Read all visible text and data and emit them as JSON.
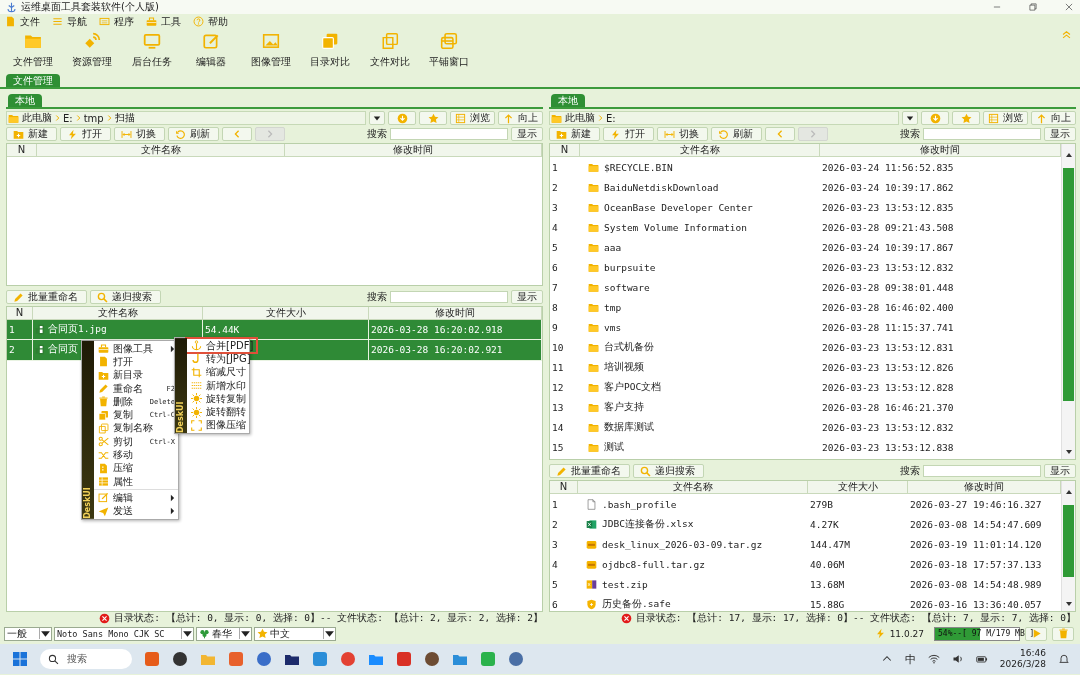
{
  "window": {
    "title": "运维桌面工具套装软件(个人版)"
  },
  "menu": [
    {
      "label": "文件"
    },
    {
      "label": "导航"
    },
    {
      "label": "程序"
    },
    {
      "label": "工具"
    },
    {
      "label": "帮助"
    }
  ],
  "toolbar": [
    {
      "label": "文件管理"
    },
    {
      "label": "资源管理"
    },
    {
      "label": "后台任务"
    },
    {
      "label": "编辑器"
    },
    {
      "label": "图像管理"
    },
    {
      "label": "目录对比"
    },
    {
      "label": "文件对比"
    },
    {
      "label": "平铺窗口"
    }
  ],
  "main_tabs": [
    {
      "label": "文件管理",
      "selected": true
    }
  ],
  "panes": [
    {
      "tab": {
        "label": "本地",
        "selected": true
      },
      "path": [
        "此电脑",
        "E:",
        "tmp",
        "扫描"
      ],
      "nav_buttons": [
        {
          "label": "浏览"
        },
        {
          "label": "向上"
        }
      ],
      "actions": [
        {
          "label": "新建"
        },
        {
          "label": "打开"
        },
        {
          "label": "切换"
        },
        {
          "label": "刷新"
        }
      ],
      "history": [
        {
          "disabled": false
        },
        {
          "disabled": true
        }
      ],
      "search_label": "搜索",
      "show_button": "显示",
      "dirs": {
        "columns": [
          "N",
          "文件名称",
          "修改时间"
        ]
      },
      "file_tools": [
        {
          "label": "批量重命名"
        },
        {
          "label": "递归搜索"
        }
      ],
      "files_search_label": "搜索",
      "files_show_button": "显示",
      "files": {
        "columns": [
          "N",
          "文件名称",
          "文件大小",
          "修改时间"
        ],
        "rows": [
          {
            "n": "1",
            "kind": "image",
            "name": "合同页1.jpg",
            "size": "54.44K",
            "time": "2026-03-28 16:20:02.918",
            "selected": true
          },
          {
            "n": "2",
            "kind": "image",
            "name": "合同页",
            "time": "2026-03-28 16:20:02.921",
            "selected": true
          }
        ]
      },
      "status": "目录状态: 【总计: 0, 显示: 0, 选择: 0】-- 文件状态: 【总计: 2, 显示: 2, 选择: 2】"
    },
    {
      "tab": {
        "label": "本地",
        "selected": true
      },
      "path": [
        "此电脑",
        "E:"
      ],
      "nav_buttons": [
        {
          "label": "浏览"
        },
        {
          "label": "向上"
        }
      ],
      "actions": [
        {
          "label": "新建"
        },
        {
          "label": "打开"
        },
        {
          "label": "切换"
        },
        {
          "label": "刷新"
        }
      ],
      "history": [
        {
          "disabled": false
        },
        {
          "disabled": true
        }
      ],
      "search_label": "搜索",
      "show_button": "显示",
      "dirs": {
        "columns": [
          "N",
          "文件名称",
          "修改时间"
        ],
        "rows": [
          {
            "n": "1",
            "name": "$RECYCLE.BIN",
            "time": "2026-03-24 11:56:52.835",
            "selected": false
          },
          {
            "n": "2",
            "name": "BaiduNetdiskDownload",
            "time": "2026-03-24 10:39:17.862",
            "selected": false
          },
          {
            "n": "3",
            "name": "OceanBase Developer Center",
            "time": "2026-03-23 13:53:12.835",
            "selected": false
          },
          {
            "n": "4",
            "name": "System Volume Information",
            "time": "2026-03-28 09:21:43.508",
            "selected": false
          },
          {
            "n": "5",
            "name": "aaa",
            "time": "2026-03-24 10:39:17.867",
            "selected": false
          },
          {
            "n": "6",
            "name": "burpsuite",
            "time": "2026-03-23 13:53:12.832",
            "selected": false
          },
          {
            "n": "7",
            "name": "software",
            "time": "2026-03-28 09:38:01.448",
            "selected": false
          },
          {
            "n": "8",
            "name": "tmp",
            "time": "2026-03-28 16:46:02.400",
            "selected": false
          },
          {
            "n": "9",
            "name": "vms",
            "time": "2026-03-28 11:15:37.741",
            "selected": false
          },
          {
            "n": "10",
            "name": "台式机备份",
            "time": "2026-03-23 13:53:12.831",
            "selected": false
          },
          {
            "n": "11",
            "name": "培训视频",
            "time": "2026-03-23 13:53:12.826",
            "selected": false
          },
          {
            "n": "12",
            "name": "客户POC文档",
            "time": "2026-03-23 13:53:12.828",
            "selected": false
          },
          {
            "n": "13",
            "name": "客户支持",
            "time": "2026-03-28 16:46:21.370",
            "selected": false
          },
          {
            "n": "14",
            "name": "数据库测试",
            "time": "2026-03-23 13:53:12.832",
            "selected": false
          },
          {
            "n": "15",
            "name": "测试",
            "time": "2026-03-23 13:53:12.838",
            "selected": false
          }
        ]
      },
      "file_tools": [
        {
          "label": "批量重命名"
        },
        {
          "label": "递归搜索"
        }
      ],
      "files_search_label": "搜索",
      "files_show_button": "显示",
      "files": {
        "columns": [
          "N",
          "文件名称",
          "文件大小",
          "修改时间"
        ],
        "rows": [
          {
            "n": "1",
            "kind": "file",
            "name": ".bash_profile",
            "size": "279B",
            "time": "2026-03-27 19:46:16.327",
            "selected": false
          },
          {
            "n": "2",
            "kind": "excel",
            "name": "JDBC连接备份.xlsx",
            "size": "4.27K",
            "time": "2026-03-08 14:54:47.609",
            "selected": false
          },
          {
            "n": "3",
            "kind": "archive",
            "name": "desk_linux_2026-03-09.tar.gz",
            "size": "144.47M",
            "time": "2026-03-19 11:01:14.120",
            "selected": false
          },
          {
            "n": "4",
            "kind": "archive",
            "name": "ojdbc8-full.tar.gz",
            "size": "40.06M",
            "time": "2026-03-18 17:57:37.133",
            "selected": false
          },
          {
            "n": "5",
            "kind": "zip",
            "name": "test.zip",
            "size": "13.68M",
            "time": "2026-03-08 14:54:48.989",
            "selected": false
          },
          {
            "n": "6",
            "kind": "safe",
            "name": "历史备份.safe",
            "size": "15.88G",
            "time": "2026-03-16 13:36:40.057",
            "selected": false
          }
        ]
      },
      "status": "目录状态: 【总计: 17, 显示: 17, 选择: 0】-- 文件状态: 【总计: 7, 显示: 7, 选择: 0】"
    }
  ],
  "context_menu": {
    "brand": "DeskUI",
    "items": [
      {
        "kind": "item",
        "label": "图像工具",
        "submenu": true
      },
      {
        "kind": "item",
        "label": "打开"
      },
      {
        "kind": "item",
        "label": "新目录"
      },
      {
        "kind": "item",
        "label": "重命名",
        "shortcut": "F2"
      },
      {
        "kind": "item",
        "label": "删除",
        "shortcut": "Delete"
      },
      {
        "kind": "item",
        "label": "复制",
        "shortcut": "Ctrl-C"
      },
      {
        "kind": "item",
        "label": "复制名称"
      },
      {
        "kind": "item",
        "label": "剪切",
        "shortcut": "Ctrl-X"
      },
      {
        "kind": "item",
        "label": "移动"
      },
      {
        "kind": "item",
        "label": "压缩"
      },
      {
        "kind": "item",
        "label": "属性"
      },
      {
        "kind": "separator"
      },
      {
        "kind": "item",
        "label": "编辑",
        "submenu": true
      },
      {
        "kind": "item",
        "label": "发送",
        "submenu": true
      }
    ],
    "submenu": {
      "brand": "DeskUI",
      "items": [
        {
          "label": "合并[PDF]",
          "selected": true
        },
        {
          "label": "转为[JPG]",
          "selected": false
        },
        {
          "label": "缩减尺寸",
          "selected": false
        },
        {
          "label": "新增水印",
          "selected": false
        },
        {
          "label": "旋转复制",
          "selected": false
        },
        {
          "label": "旋转翻转",
          "selected": false
        },
        {
          "label": "图像压缩",
          "selected": false
        }
      ]
    }
  },
  "bottom_bar": {
    "dropdowns": [
      {
        "value": "一般"
      },
      {
        "value": "Noto Sans Mono CJK SC"
      },
      {
        "value": "春华"
      },
      {
        "value": "中文"
      }
    ],
    "version": "11.0.27",
    "memory": {
      "reading": "54%--[ 97 M/179 MB ]",
      "level": 0.54
    }
  },
  "taskbar": {
    "search_placeholder": "搜索",
    "input_method": "中",
    "time": "16:46",
    "date": "2026/3/28"
  }
}
